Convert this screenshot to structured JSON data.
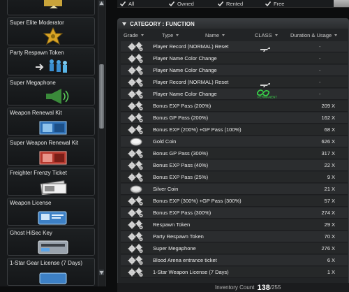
{
  "shop_list": {
    "items": [
      {
        "name": "",
        "icon": "gold-bar-icon"
      },
      {
        "name": "Super Elite Moderator",
        "icon": "sheriff-badge-icon"
      },
      {
        "name": "Party Respawn Token",
        "icon": "respawn-soldiers-icon"
      },
      {
        "name": "Super Megaphone",
        "icon": "megaphone-icon"
      },
      {
        "name": "Weapon Renewal Kit",
        "icon": "blue-toolbox-icon"
      },
      {
        "name": "Super Weapon Renewal Kit",
        "icon": "red-toolbox-icon"
      },
      {
        "name": "Freighter Frenzy Ticket",
        "icon": "ticket-stack-icon"
      },
      {
        "name": "Weapon License",
        "icon": "license-card-icon"
      },
      {
        "name": "Ghost HiSec Key",
        "icon": "keycard-icon"
      },
      {
        "name": "1-Star Gear License (7 Days)",
        "icon": "gear-license-icon"
      }
    ]
  },
  "filters": {
    "all": "All",
    "owned": "Owned",
    "rented": "Rented",
    "free": "Free"
  },
  "inventory": {
    "category_title": "CATEGORY : FUNCTION",
    "columns": {
      "grade": "Grade",
      "type": "Type",
      "name": "Name",
      "class": "CLASS",
      "duration": "Duration & Usage"
    },
    "permanent_label": "PERMANENT",
    "rows": [
      {
        "name": "Player Record (NORMAL) Reset",
        "count": "",
        "unit": "",
        "dash": "-",
        "cls": "rifle"
      },
      {
        "name": "Player Name Color Change",
        "count": "",
        "unit": "",
        "dash": "-",
        "cls": ""
      },
      {
        "name": "Player Name Color Change",
        "count": "",
        "unit": "",
        "dash": "-",
        "cls": ""
      },
      {
        "name": "Player Record (NORMAL) Reset",
        "count": "",
        "unit": "",
        "dash": "-",
        "cls": "rifle"
      },
      {
        "name": "Player Name Color Change",
        "count": "",
        "unit": "",
        "dash": "-",
        "cls": "perm"
      },
      {
        "name": "Bonus EXP Pass (200%)",
        "count": "209",
        "unit": "X",
        "dash": "",
        "cls": ""
      },
      {
        "name": "Bonus GP Pass (200%)",
        "count": "162",
        "unit": "X",
        "dash": "",
        "cls": ""
      },
      {
        "name": "Bonus EXP (200%) +GP Pass (100%)",
        "count": "68",
        "unit": "X",
        "dash": "",
        "cls": ""
      },
      {
        "name": "Gold Coin",
        "count": "626",
        "unit": "X",
        "dash": "",
        "cls": "",
        "coin": "gold"
      },
      {
        "name": "Bonus GP Pass (300%)",
        "count": "317",
        "unit": "X",
        "dash": "",
        "cls": ""
      },
      {
        "name": "Bonus EXP Pass (40%)",
        "count": "22",
        "unit": "X",
        "dash": "",
        "cls": ""
      },
      {
        "name": "Bonus EXP Pass (25%)",
        "count": "9",
        "unit": "X",
        "dash": "",
        "cls": ""
      },
      {
        "name": "Silver Coin",
        "count": "21",
        "unit": "X",
        "dash": "",
        "cls": "",
        "coin": "silver"
      },
      {
        "name": "Bonus EXP (300%) +GP Pass (300%)",
        "count": "57",
        "unit": "X",
        "dash": "",
        "cls": ""
      },
      {
        "name": "Bonus EXP Pass (300%)",
        "count": "274",
        "unit": "X",
        "dash": "",
        "cls": ""
      },
      {
        "name": "Respawn Token",
        "count": "29",
        "unit": "X",
        "dash": "",
        "cls": ""
      },
      {
        "name": "Party Respawn Token",
        "count": "70",
        "unit": "X",
        "dash": "",
        "cls": ""
      },
      {
        "name": "Super Megaphone",
        "count": "276",
        "unit": "X",
        "dash": "",
        "cls": ""
      },
      {
        "name": "Blood Arena entrance ticket",
        "count": "6",
        "unit": "X",
        "dash": "",
        "cls": ""
      },
      {
        "name": "1-Star Weapon License (7 Days)",
        "count": "1",
        "unit": "X",
        "dash": "",
        "cls": ""
      }
    ],
    "footer": {
      "label": "Inventory Count",
      "current": "138",
      "max": "/255"
    }
  },
  "colors": {
    "panel_bg": "#222426",
    "row_bg": "#2b2d2f",
    "text": "#eaeaea",
    "permanent_green": "#39d94a"
  }
}
